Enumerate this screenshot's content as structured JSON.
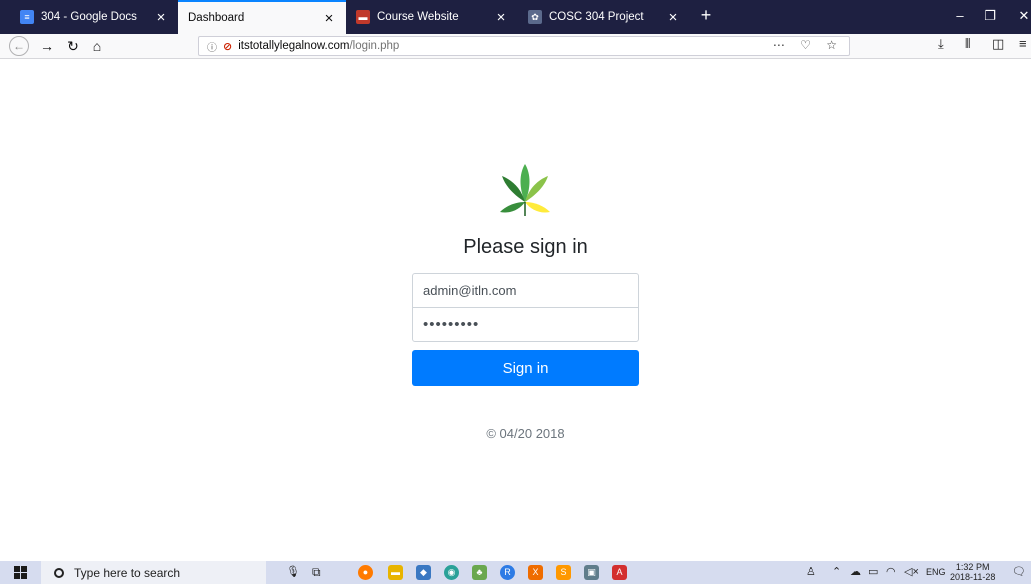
{
  "browser": {
    "tabs": [
      {
        "label": "304 - Google Docs",
        "icon": "google-docs-icon",
        "active": false
      },
      {
        "label": "Dashboard",
        "icon": "",
        "active": true
      },
      {
        "label": "Course Website",
        "icon": "course-website-icon",
        "active": false
      },
      {
        "label": "COSC 304 Project",
        "icon": "project-icon",
        "active": false
      }
    ],
    "url_domain": "itstotallylegalnow.com",
    "url_path": "/login.php"
  },
  "login": {
    "heading": "Please sign in",
    "email_value": "admin@itln.com",
    "password_mask": "•••••••••",
    "signin_label": "Sign in",
    "copyright": "© 04/20 2018"
  },
  "taskbar": {
    "search_placeholder": "Type here to search",
    "lang": "ENG",
    "time": "1:32 PM",
    "date": "2018-11-28"
  },
  "colors": {
    "accent": "#007bff",
    "tabbar": "#1e2041",
    "taskbar": "#d6dcef"
  }
}
